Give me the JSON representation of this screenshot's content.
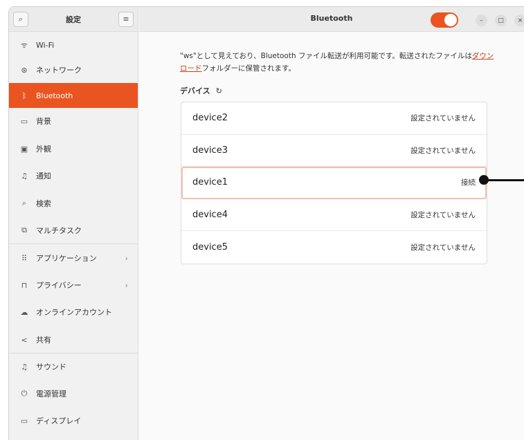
{
  "sidebar": {
    "title": "設定",
    "items": [
      {
        "label": "Wi-Fi",
        "icon": "wifi-icon",
        "glyph": "ᯤ"
      },
      {
        "label": "ネットワーク",
        "icon": "network-icon",
        "glyph": "⊛"
      },
      {
        "label": "Bluetooth",
        "icon": "bluetooth-icon",
        "glyph": "ᛒ"
      },
      {
        "label": "背景",
        "icon": "background-icon",
        "glyph": "▭"
      },
      {
        "label": "外観",
        "icon": "appearance-icon",
        "glyph": "▣"
      },
      {
        "label": "通知",
        "icon": "bell-icon",
        "glyph": "♫"
      },
      {
        "label": "検索",
        "icon": "search-icon",
        "glyph": "⌕"
      },
      {
        "label": "マルチタスク",
        "icon": "multitask-icon",
        "glyph": "⧉"
      },
      {
        "label": "アプリケーション",
        "icon": "apps-icon",
        "glyph": "⠿"
      },
      {
        "label": "プライバシー",
        "icon": "lock-icon",
        "glyph": "🔒︎"
      },
      {
        "label": "オンラインアカウント",
        "icon": "cloud-icon",
        "glyph": "☁"
      },
      {
        "label": "共有",
        "icon": "share-icon",
        "glyph": "<"
      },
      {
        "label": "サウンド",
        "icon": "music-icon",
        "glyph": "♫"
      },
      {
        "label": "電源管理",
        "icon": "power-icon",
        "glyph": "⏻"
      },
      {
        "label": "ディスプレイ",
        "icon": "display-icon",
        "glyph": "▭"
      }
    ]
  },
  "header": {
    "title": "Bluetooth",
    "bluetooth_enabled": true
  },
  "main": {
    "description_part1": "\"ws\"として見えており、Bluetooth ファイル転送が利用可能です。転送されたファイルは",
    "description_link": "ダウンロード",
    "description_part2": "フォルダーに保管されます。",
    "devices_heading": "デバイス",
    "devices": [
      {
        "name": "device2",
        "status": "設定されていません"
      },
      {
        "name": "device3",
        "status": "設定されていません"
      },
      {
        "name": "device1",
        "status": "接続"
      },
      {
        "name": "device4",
        "status": "設定されていません"
      },
      {
        "name": "device5",
        "status": "設定されていません"
      }
    ]
  },
  "colors": {
    "accent": "#e95420"
  }
}
